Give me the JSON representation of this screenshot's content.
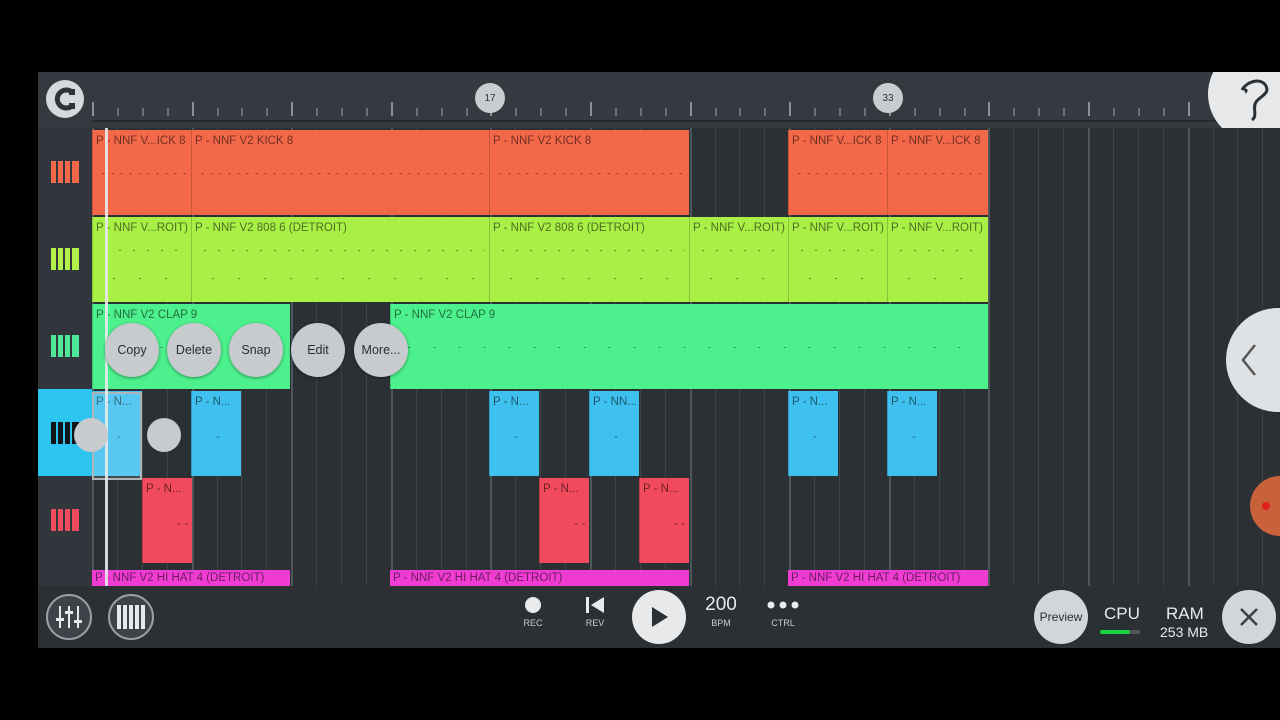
{
  "ruler": {
    "markers": [
      "17",
      "33"
    ]
  },
  "tracks": [
    {
      "color": "#f4684a",
      "icon_color": "#f4684a"
    },
    {
      "color": "#a8ef46",
      "icon_color": "#b4f04a"
    },
    {
      "color": "#4cf08c",
      "icon_color": "#4ee89a"
    },
    {
      "color": "#3fc1ef",
      "icon_color": "#111418"
    },
    {
      "color": "#f04a5c",
      "icon_color": "#f04a5c"
    }
  ],
  "patterns": {
    "kick": [
      "P - NNF V...ICK 8",
      "P - NNF V2 KICK 8",
      "P - NNF V2 KICK 8",
      "P - NNF V...ICK 8",
      "P - NNF V...ICK 8"
    ],
    "bass": [
      "P - NNF V...ROIT)",
      "P - NNF V2 808 6 (DETROIT)",
      "P - NNF V2 808 6 (DETROIT)",
      "P - NNF V...ROIT)",
      "P - NNF V...ROIT)",
      "P - NNF V...ROIT)"
    ],
    "clap": [
      "P - NNF V2 CLAP 9",
      "P - NNF V2 CLAP 9"
    ],
    "perc": [
      "P - N...",
      "P - N...",
      "P - N...",
      "P - NN...",
      "P - N...",
      "P - N..."
    ],
    "snare": [
      "P - N...",
      "P - N...",
      "P - N..."
    ],
    "hat": [
      "P - NNF V2 HI HAT 4 (DETROIT)",
      "P - NNF V2 HI HAT 4 (DETROIT)",
      "P - NNF V2 HI HAT 4 (DETROIT)"
    ]
  },
  "context_menu": {
    "copy": "Copy",
    "delete": "Delete",
    "snap": "Snap",
    "edit": "Edit",
    "more": "More..."
  },
  "transport": {
    "rec": "REC",
    "rev": "REV",
    "bpm_value": "200",
    "bpm_label": "BPM",
    "ctrl": "CTRL"
  },
  "status": {
    "preview": "Preview",
    "cpu": "CPU",
    "ram": "RAM",
    "ram_value": "253 MB"
  },
  "colors": {
    "hat": "#f03cd2",
    "background": "#2f353a"
  }
}
